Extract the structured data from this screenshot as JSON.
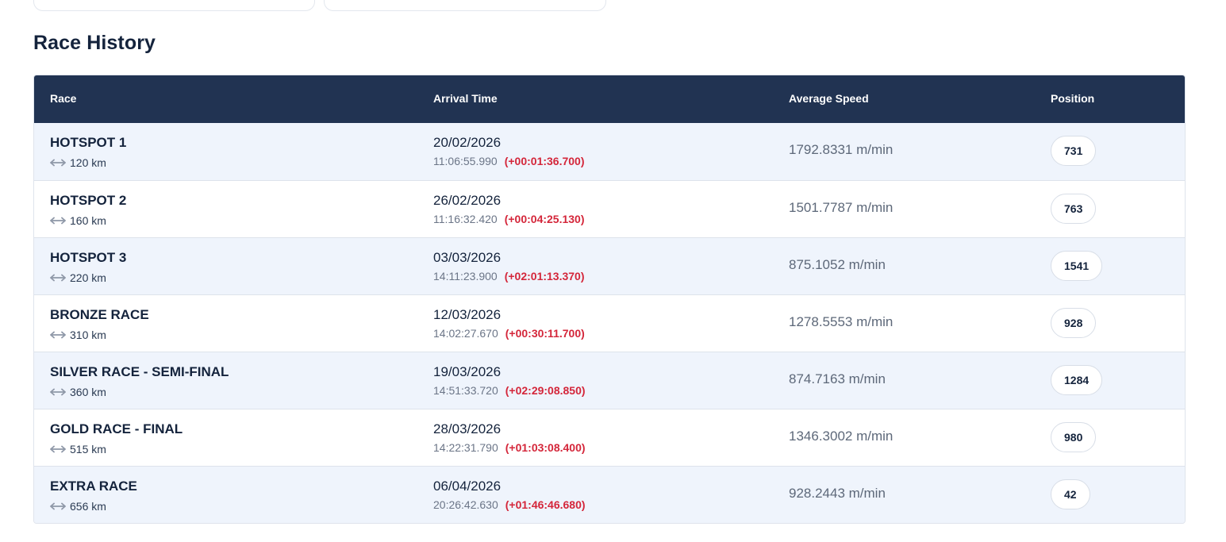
{
  "section": {
    "title": "Race History"
  },
  "table": {
    "headers": {
      "race": "Race",
      "arrival_time": "Arrival Time",
      "average_speed": "Average Speed",
      "position": "Position"
    },
    "rows": [
      {
        "race": "HOTSPOT 1",
        "distance": "120 km",
        "date": "20/02/2026",
        "time": "11:06:55.990",
        "delta": "(+00:01:36.700)",
        "speed": "1792.8331 m/min",
        "position": "731"
      },
      {
        "race": "HOTSPOT 2",
        "distance": "160 km",
        "date": "26/02/2026",
        "time": "11:16:32.420",
        "delta": "(+00:04:25.130)",
        "speed": "1501.7787 m/min",
        "position": "763"
      },
      {
        "race": "HOTSPOT 3",
        "distance": "220 km",
        "date": "03/03/2026",
        "time": "14:11:23.900",
        "delta": "(+02:01:13.370)",
        "speed": "875.1052 m/min",
        "position": "1541"
      },
      {
        "race": "BRONZE RACE",
        "distance": "310 km",
        "date": "12/03/2026",
        "time": "14:02:27.670",
        "delta": "(+00:30:11.700)",
        "speed": "1278.5553 m/min",
        "position": "928"
      },
      {
        "race": "SILVER RACE - SEMI-FINAL",
        "distance": "360 km",
        "date": "19/03/2026",
        "time": "14:51:33.720",
        "delta": "(+02:29:08.850)",
        "speed": "874.7163 m/min",
        "position": "1284"
      },
      {
        "race": "GOLD RACE - FINAL",
        "distance": "515 km",
        "date": "28/03/2026",
        "time": "14:22:31.790",
        "delta": "(+01:03:08.400)",
        "speed": "1346.3002 m/min",
        "position": "980"
      },
      {
        "race": "EXTRA RACE",
        "distance": "656 km",
        "date": "06/04/2026",
        "time": "20:26:42.630",
        "delta": "(+01:46:46.680)",
        "speed": "928.2443 m/min",
        "position": "42"
      }
    ]
  },
  "icons": {
    "distance": "distance-arrows-icon"
  },
  "colors": {
    "header_bg": "#213352",
    "row_alt_bg": "#eff4fc",
    "delta_red": "#d4263a",
    "title_text": "#14233c"
  }
}
